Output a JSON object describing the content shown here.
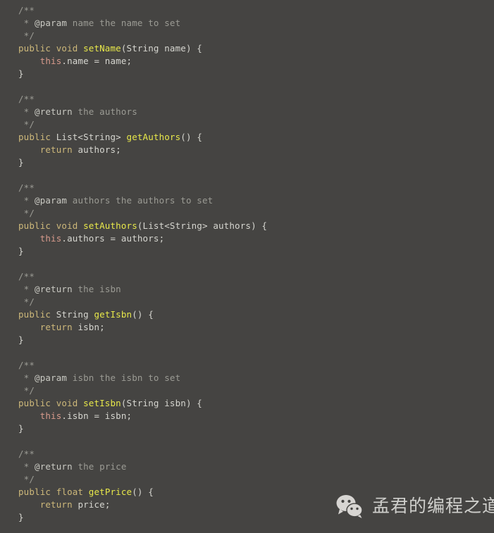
{
  "document": {
    "type": "java-source-code",
    "background_color": "#454442",
    "theme": "dark",
    "colors": {
      "background": "#454442",
      "comment": "#9b9b94",
      "javadoc_tag": "#c9c9c2",
      "keyword": "#cdb87a",
      "method_name": "#e8e84a",
      "this_keyword": "#d79a8c",
      "plain_text": "#d6d6d0"
    }
  },
  "code": {
    "language": "Java",
    "lines": [
      {
        "indent": 0,
        "tokens": [
          {
            "t": "/**",
            "c": "cmt"
          }
        ]
      },
      {
        "indent": 0,
        "tokens": [
          {
            "t": " * ",
            "c": "cmt"
          },
          {
            "t": "@param",
            "c": "tag"
          },
          {
            "t": " name the name to set",
            "c": "cmt"
          }
        ]
      },
      {
        "indent": 0,
        "tokens": [
          {
            "t": " */",
            "c": "cmt"
          }
        ]
      },
      {
        "indent": 0,
        "tokens": [
          {
            "t": "public void ",
            "c": "kw"
          },
          {
            "t": "setName",
            "c": "mth"
          },
          {
            "t": "(String name) {",
            "c": "pl"
          }
        ]
      },
      {
        "indent": 0,
        "tokens": [
          {
            "t": "    ",
            "c": "pl"
          },
          {
            "t": "this",
            "c": "ths"
          },
          {
            "t": ".name = name;",
            "c": "pl"
          }
        ]
      },
      {
        "indent": 0,
        "tokens": [
          {
            "t": "}",
            "c": "pl"
          }
        ]
      },
      {
        "indent": 0,
        "tokens": []
      },
      {
        "indent": 0,
        "tokens": [
          {
            "t": "/**",
            "c": "cmt"
          }
        ]
      },
      {
        "indent": 0,
        "tokens": [
          {
            "t": " * ",
            "c": "cmt"
          },
          {
            "t": "@return",
            "c": "tag"
          },
          {
            "t": " the authors",
            "c": "cmt"
          }
        ]
      },
      {
        "indent": 0,
        "tokens": [
          {
            "t": " */",
            "c": "cmt"
          }
        ]
      },
      {
        "indent": 0,
        "tokens": [
          {
            "t": "public ",
            "c": "kw"
          },
          {
            "t": "List<String> ",
            "c": "pl"
          },
          {
            "t": "getAuthors",
            "c": "mth"
          },
          {
            "t": "() {",
            "c": "pl"
          }
        ]
      },
      {
        "indent": 0,
        "tokens": [
          {
            "t": "    ",
            "c": "pl"
          },
          {
            "t": "return",
            "c": "kw"
          },
          {
            "t": " authors;",
            "c": "pl"
          }
        ]
      },
      {
        "indent": 0,
        "tokens": [
          {
            "t": "}",
            "c": "pl"
          }
        ]
      },
      {
        "indent": 0,
        "tokens": []
      },
      {
        "indent": 0,
        "tokens": [
          {
            "t": "/**",
            "c": "cmt"
          }
        ]
      },
      {
        "indent": 0,
        "tokens": [
          {
            "t": " * ",
            "c": "cmt"
          },
          {
            "t": "@param",
            "c": "tag"
          },
          {
            "t": " authors the authors to set",
            "c": "cmt"
          }
        ]
      },
      {
        "indent": 0,
        "tokens": [
          {
            "t": " */",
            "c": "cmt"
          }
        ]
      },
      {
        "indent": 0,
        "tokens": [
          {
            "t": "public void ",
            "c": "kw"
          },
          {
            "t": "setAuthors",
            "c": "mth"
          },
          {
            "t": "(List<String> authors) {",
            "c": "pl"
          }
        ]
      },
      {
        "indent": 0,
        "tokens": [
          {
            "t": "    ",
            "c": "pl"
          },
          {
            "t": "this",
            "c": "ths"
          },
          {
            "t": ".authors = authors;",
            "c": "pl"
          }
        ]
      },
      {
        "indent": 0,
        "tokens": [
          {
            "t": "}",
            "c": "pl"
          }
        ]
      },
      {
        "indent": 0,
        "tokens": []
      },
      {
        "indent": 0,
        "tokens": [
          {
            "t": "/**",
            "c": "cmt"
          }
        ]
      },
      {
        "indent": 0,
        "tokens": [
          {
            "t": " * ",
            "c": "cmt"
          },
          {
            "t": "@return",
            "c": "tag"
          },
          {
            "t": " the isbn",
            "c": "cmt"
          }
        ]
      },
      {
        "indent": 0,
        "tokens": [
          {
            "t": " */",
            "c": "cmt"
          }
        ]
      },
      {
        "indent": 0,
        "tokens": [
          {
            "t": "public ",
            "c": "kw"
          },
          {
            "t": "String ",
            "c": "pl"
          },
          {
            "t": "getIsbn",
            "c": "mth"
          },
          {
            "t": "() {",
            "c": "pl"
          }
        ]
      },
      {
        "indent": 0,
        "tokens": [
          {
            "t": "    ",
            "c": "pl"
          },
          {
            "t": "return",
            "c": "kw"
          },
          {
            "t": " isbn;",
            "c": "pl"
          }
        ]
      },
      {
        "indent": 0,
        "tokens": [
          {
            "t": "}",
            "c": "pl"
          }
        ]
      },
      {
        "indent": 0,
        "tokens": []
      },
      {
        "indent": 0,
        "tokens": [
          {
            "t": "/**",
            "c": "cmt"
          }
        ]
      },
      {
        "indent": 0,
        "tokens": [
          {
            "t": " * ",
            "c": "cmt"
          },
          {
            "t": "@param",
            "c": "tag"
          },
          {
            "t": " isbn the isbn to set",
            "c": "cmt"
          }
        ]
      },
      {
        "indent": 0,
        "tokens": [
          {
            "t": " */",
            "c": "cmt"
          }
        ]
      },
      {
        "indent": 0,
        "tokens": [
          {
            "t": "public void ",
            "c": "kw"
          },
          {
            "t": "setIsbn",
            "c": "mth"
          },
          {
            "t": "(String isbn) {",
            "c": "pl"
          }
        ]
      },
      {
        "indent": 0,
        "tokens": [
          {
            "t": "    ",
            "c": "pl"
          },
          {
            "t": "this",
            "c": "ths"
          },
          {
            "t": ".isbn = isbn;",
            "c": "pl"
          }
        ]
      },
      {
        "indent": 0,
        "tokens": [
          {
            "t": "}",
            "c": "pl"
          }
        ]
      },
      {
        "indent": 0,
        "tokens": []
      },
      {
        "indent": 0,
        "tokens": [
          {
            "t": "/**",
            "c": "cmt"
          }
        ]
      },
      {
        "indent": 0,
        "tokens": [
          {
            "t": " * ",
            "c": "cmt"
          },
          {
            "t": "@return",
            "c": "tag"
          },
          {
            "t": " the price",
            "c": "cmt"
          }
        ]
      },
      {
        "indent": 0,
        "tokens": [
          {
            "t": " */",
            "c": "cmt"
          }
        ]
      },
      {
        "indent": 0,
        "tokens": [
          {
            "t": "public float ",
            "c": "kw"
          },
          {
            "t": "getPrice",
            "c": "mth"
          },
          {
            "t": "() {",
            "c": "pl"
          }
        ]
      },
      {
        "indent": 0,
        "tokens": [
          {
            "t": "    ",
            "c": "pl"
          },
          {
            "t": "return",
            "c": "kw"
          },
          {
            "t": " price;",
            "c": "pl"
          }
        ]
      },
      {
        "indent": 0,
        "tokens": [
          {
            "t": "}",
            "c": "pl"
          }
        ]
      }
    ]
  },
  "watermark": {
    "icon": "wechat-logo-icon",
    "text": "孟君的编程之道",
    "color": "#e2e2de"
  }
}
